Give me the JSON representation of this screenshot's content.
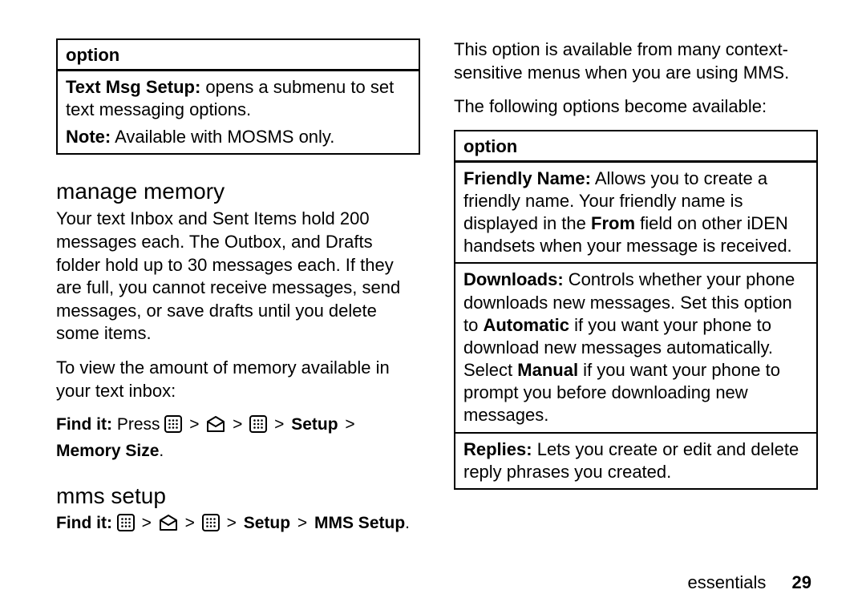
{
  "leftBox": {
    "header": "option",
    "p1_bold": "Text Msg Setup:",
    "p1_rest": " opens a submenu to set text messaging options.",
    "p2_bold": "Note:",
    "p2_rest": " Available with MOSMS only."
  },
  "manageMemory": {
    "heading": "manage memory",
    "p1": "Your text Inbox and Sent Items hold 200 messages each. The Outbox, and Drafts folder hold up to 30 messages each. If they are full, you cannot receive messages, send messages, or save drafts until you delete some items.",
    "p2": "To view the amount of memory available in your text inbox:",
    "findit_label": "Find it:",
    "findit_press": " Press ",
    "gt": ">",
    "path_setup": "Setup",
    "path_memsize": "Memory Size",
    "period": "."
  },
  "mmsSetup": {
    "heading": "mms setup",
    "findit_label": "Find it:",
    "gt": ">",
    "path_setup": "Setup",
    "path_mmssetup": "MMS Setup",
    "period": "."
  },
  "rightIntro": {
    "p1": "This option is available from many context-sensitive menus when you are using MMS.",
    "p2": "The following options become available:"
  },
  "rightBox": {
    "header": "option",
    "row1_bold": "Friendly Name:",
    "row1_rest_a": " Allows you to create a friendly name. Your friendly name is displayed in the ",
    "row1_bold2": "From",
    "row1_rest_b": " field on other iDEN handsets when your message is received.",
    "row2_bold": "Downloads:",
    "row2_rest_a": " Controls whether your phone downloads new messages. Set this option to ",
    "row2_bold2": "Automatic",
    "row2_rest_b": " if you want your phone to download new messages automatically. Select ",
    "row2_bold3": "Manual",
    "row2_rest_c": " if you want your phone to prompt you before downloading new messages.",
    "row3_bold": "Replies:",
    "row3_rest": " Lets you create or edit and delete reply phrases you created."
  },
  "footer": {
    "label": "essentials",
    "page": "29"
  }
}
